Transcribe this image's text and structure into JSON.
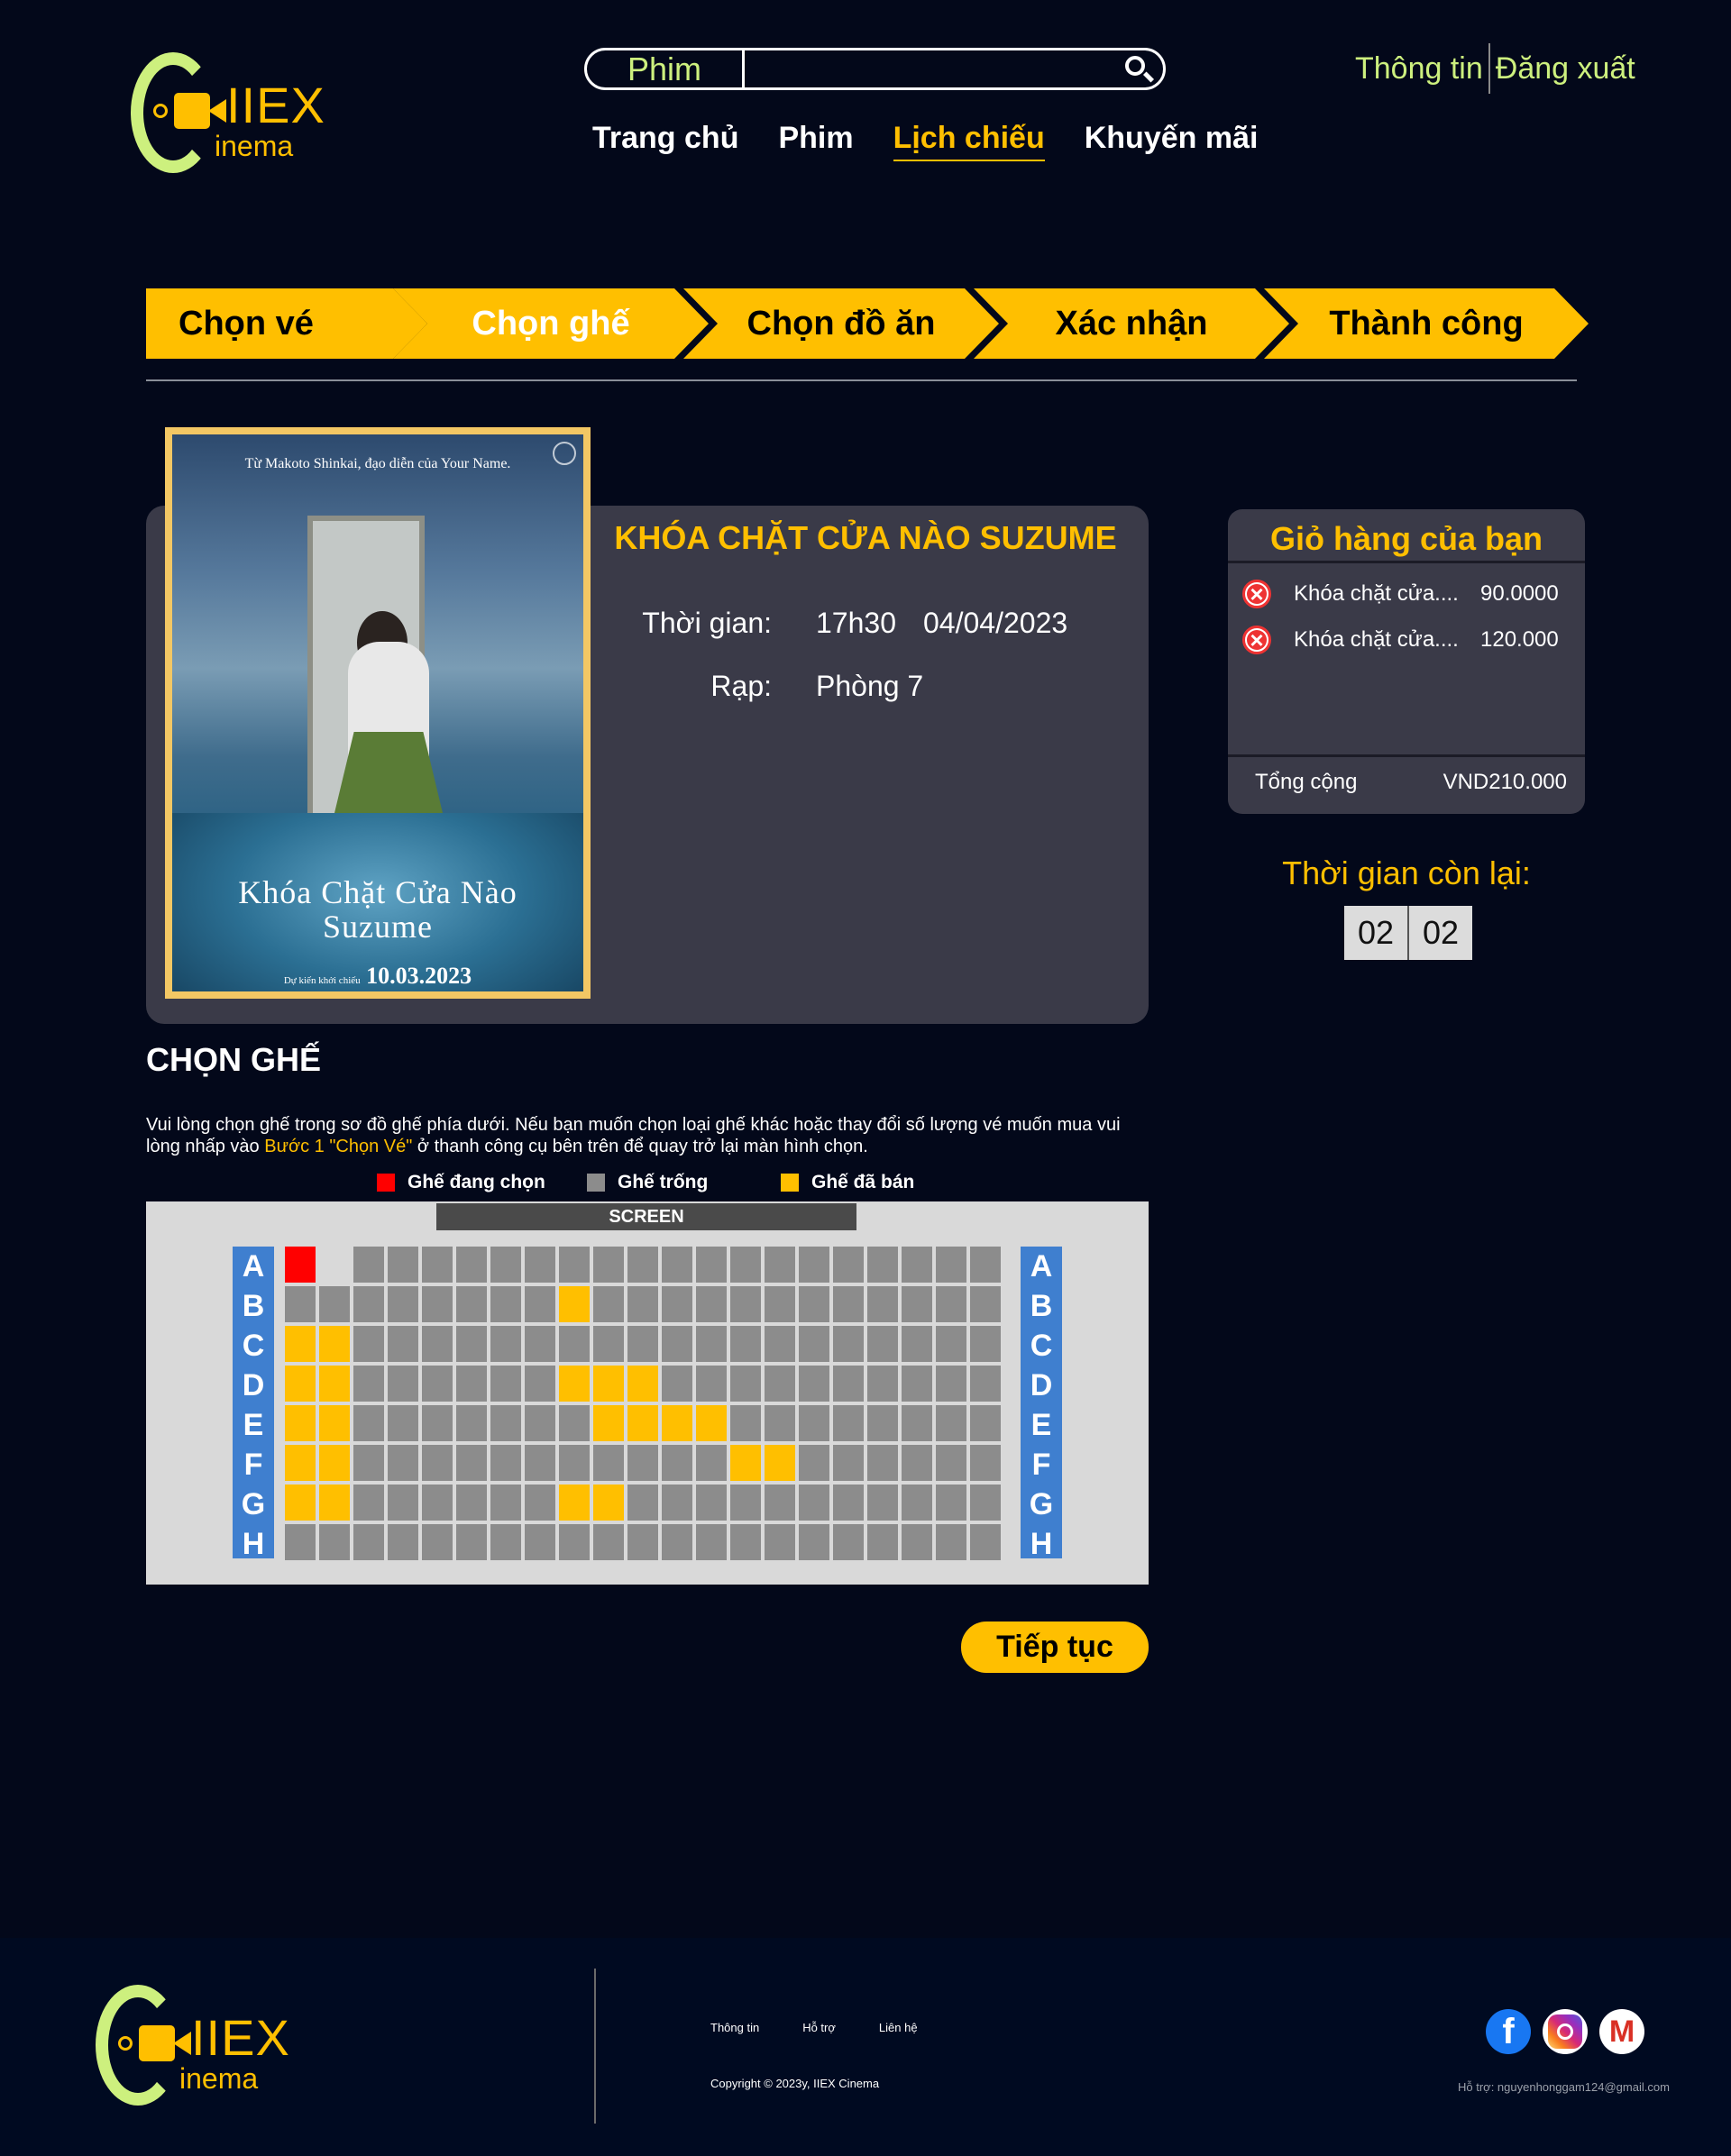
{
  "header": {
    "logo": {
      "brand": "IIEX",
      "sub": "inema"
    },
    "search": {
      "category": "Phim",
      "placeholder": ""
    },
    "nav": [
      "Trang chủ",
      "Phim",
      "Lịch chiếu",
      "Khuyến mãi"
    ],
    "nav_active_index": 2,
    "user_links": {
      "info": "Thông tin",
      "logout": "Đăng xuất"
    }
  },
  "steps": [
    "Chọn vé",
    "Chọn ghế",
    "Chọn đồ ăn",
    "Xác nhận",
    "Thành công"
  ],
  "current_step_index": 1,
  "movie": {
    "title": "KHÓA CHẶT CỬA NÀO SUZUME",
    "time_label": "Thời gian:",
    "time": "17h30",
    "date": "04/04/2023",
    "room_label": "Rạp:",
    "room": "Phòng 7",
    "poster": {
      "tagline": "Từ Makoto Shinkai, đạo diễn của Your Name.",
      "title_line1": "Khóa Chặt Cửa Nào",
      "title_line2": "Suzume",
      "release_small": "Dự kiến khởi chiếu",
      "release_date": "10.03.2023"
    }
  },
  "cart": {
    "title": "Giỏ hàng của bạn",
    "items": [
      {
        "name": "Khóa chặt cửa....",
        "price": "90.0000"
      },
      {
        "name": "Khóa chặt cửa....",
        "price": "120.000"
      }
    ],
    "total_label": "Tổng cộng",
    "total_value": "VND210.000"
  },
  "timer": {
    "label": "Thời gian còn lại:",
    "minutes": "02",
    "seconds": "02"
  },
  "seat_section": {
    "title": "CHỌN GHẾ",
    "desc_part1": "Vui lòng chọn ghế trong sơ đồ ghế phía dưới. Nếu bạn muốn chọn loại ghế khác hoặc thay đổi số lượng vé muốn mua vui lòng nhấp vào ",
    "desc_highlight": "Bước 1 \"Chọn Vé\"",
    "desc_part2": " ở thanh công cụ bên trên để quay trở lại màn hình chọn.",
    "legend": {
      "selected": "Ghế đang chọn",
      "empty": "Ghế trống",
      "sold": "Ghế đã bán"
    },
    "screen_label": "SCREEN",
    "rows": [
      "A",
      "B",
      "C",
      "D",
      "E",
      "F",
      "G",
      "H"
    ],
    "seat_map": [
      "X.------------------------",
      "--------S----------------",
      "SS-----------------------",
      "SS------SSS--------------",
      "SS-------SSSS------------",
      "SS-----------SS----------",
      "SS------SS---------------",
      "-------------------------"
    ],
    "seat_map_legend": {
      "X": "chosen",
      "S": "sold",
      "-": "empty",
      ".": "gap"
    },
    "continue": "Tiếp tục"
  },
  "colors": {
    "accent": "#ffbf00",
    "lime": "#cdf07e",
    "background": "#03081a",
    "card": "#3a3a48",
    "seat_empty": "#8c8c8c",
    "seat_sold": "#ffbf00",
    "seat_chosen": "#ff0000",
    "row_label": "#3f7fcf"
  },
  "footer": {
    "links": [
      "Thông tin",
      "Hỗ trợ",
      "Liên hệ"
    ],
    "copyright": "Copyright © 2023y, IIEX Cinema",
    "support": "Hỗ trợ: nguyenhonggam124@gmail.com",
    "social_icons": [
      "facebook-icon",
      "instagram-icon",
      "gmail-icon"
    ]
  }
}
